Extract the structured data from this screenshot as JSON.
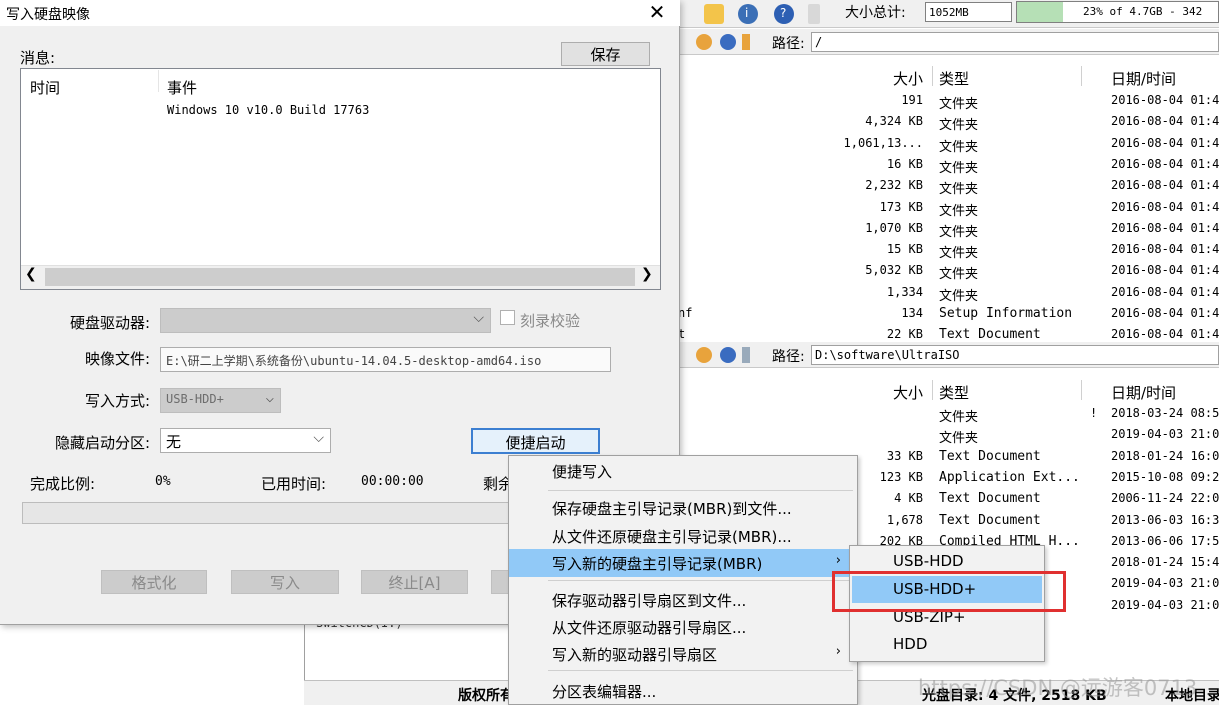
{
  "background": {
    "toolbar": {
      "size_label": "大小总计:",
      "size_value": "1052MB",
      "progress_text": "23% of 4.7GB - 342",
      "progress_percent": 23
    },
    "top_pane": {
      "path_label": "路径:",
      "path_value": "/",
      "headers": {
        "size": "大小",
        "type": "类型",
        "date": "日期/时间"
      },
      "rows": [
        {
          "name": "",
          "size": "191",
          "type": "文件夹",
          "date": "2016-08-04 01:4"
        },
        {
          "name": "",
          "size": "4,324 KB",
          "type": "文件夹",
          "date": "2016-08-04 01:4"
        },
        {
          "name": "",
          "size": "1,061,13...",
          "type": "文件夹",
          "date": "2016-08-04 01:4"
        },
        {
          "name": "",
          "size": "16 KB",
          "type": "文件夹",
          "date": "2016-08-04 01:4"
        },
        {
          "name": "",
          "size": "2,232 KB",
          "type": "文件夹",
          "date": "2016-08-04 01:4"
        },
        {
          "name": "",
          "size": "173 KB",
          "type": "文件夹",
          "date": "2016-08-04 01:4"
        },
        {
          "name": "",
          "size": "1,070 KB",
          "type": "文件夹",
          "date": "2016-08-04 01:4"
        },
        {
          "name": "",
          "size": "15 KB",
          "type": "文件夹",
          "date": "2016-08-04 01:4"
        },
        {
          "name": "",
          "size": "5,032 KB",
          "type": "文件夹",
          "date": "2016-08-04 01:4"
        },
        {
          "name": "",
          "size": "1,334",
          "type": "文件夹",
          "date": "2016-08-04 01:4"
        },
        {
          "name": "nf",
          "size": "134",
          "type": "Setup Information",
          "date": "2016-08-04 01:4"
        },
        {
          "name": "t",
          "size": "22 KB",
          "type": "Text Document",
          "date": "2016-08-04 01:4"
        }
      ]
    },
    "bottom_pane": {
      "path_label": "路径:",
      "path_value": "D:\\software\\UltraISO",
      "headers": {
        "size": "大小",
        "type": "类型",
        "date": "日期/时间"
      },
      "rows": [
        {
          "size": "",
          "type": "文件夹",
          "flag": "!",
          "date": "2018-03-24 08:5"
        },
        {
          "size": "",
          "type": "文件夹",
          "flag": "",
          "date": "2019-04-03 21:0"
        },
        {
          "size": "33 KB",
          "type": "Text Document",
          "flag": "",
          "date": "2018-01-24 16:0"
        },
        {
          "size": "123 KB",
          "type": "Application Ext...",
          "flag": "",
          "date": "2015-10-08 09:2"
        },
        {
          "size": "4 KB",
          "type": "Text Document",
          "flag": "",
          "date": "2006-11-24 22:0"
        },
        {
          "size": "1,678",
          "type": "Text Document",
          "flag": "",
          "date": "2013-06-03 16:3"
        },
        {
          "size": "202 KB",
          "type": "Compiled HTML H...",
          "flag": "",
          "date": "2013-06-06 17:5"
        },
        {
          "size": "",
          "type": "",
          "flag": "",
          "date": "2018-01-24 15:4"
        },
        {
          "size": "",
          "type": ")",
          "flag": "",
          "date": "2019-04-03 21:0"
        },
        {
          "size": "",
          "type": "",
          "flag": "",
          "date": "2019-04-03 21:0"
        }
      ]
    },
    "tree_item": "SwitchCD(I:)",
    "status": {
      "copyright": "版权所有",
      "count": "光盘目录: 4 文件, 2518 KB",
      "local": "本地目录"
    },
    "watermark": "https://CSDN @远游客0713"
  },
  "dialog": {
    "title": "写入硬盘映像",
    "messages_label": "消息:",
    "save_button": "保存",
    "columns": {
      "time": "时间",
      "event": "事件"
    },
    "message_line": "Windows 10 v10.0 Build 17763",
    "disk_drive_label": "硬盘驱动器:",
    "disk_drive_value": "",
    "verify_label": "刻录校验",
    "image_file_label": "映像文件:",
    "image_file_value": "E:\\研二上学期\\系统备份\\ubuntu-14.04.5-desktop-amd64.iso",
    "write_method_label": "写入方式:",
    "write_method_value": "USB-HDD+",
    "hidden_partition_label": "隐藏启动分区:",
    "hidden_partition_value": "无",
    "quick_boot_button": "便捷启动",
    "progress_label": "完成比例:",
    "progress_value": "0%",
    "elapsed_label": "已用时间:",
    "elapsed_value": "00:00:00",
    "remaining_label": "剩余",
    "progress_percent": 0,
    "buttons": {
      "format": "格式化",
      "write": "写入",
      "stop": "终止[A]"
    }
  },
  "context_menu": {
    "items": [
      {
        "label": "便捷写入",
        "has_submenu": false
      },
      {
        "label": "保存硬盘主引导记录(MBR)到文件...",
        "has_submenu": false
      },
      {
        "label": "从文件还原硬盘主引导记录(MBR)...",
        "has_submenu": false
      },
      {
        "label": "写入新的硬盘主引导记录(MBR)",
        "has_submenu": true,
        "active": true
      },
      {
        "label": "保存驱动器引导扇区到文件...",
        "has_submenu": false
      },
      {
        "label": "从文件还原驱动器引导扇区...",
        "has_submenu": false
      },
      {
        "label": "写入新的驱动器引导扇区",
        "has_submenu": true
      },
      {
        "label": "分区表编辑器...",
        "has_submenu": false
      }
    ],
    "submenu": [
      {
        "label": "USB-HDD"
      },
      {
        "label": "USB-HDD+",
        "active": true
      },
      {
        "label": "USB-ZIP+"
      },
      {
        "label": "HDD"
      }
    ]
  },
  "colors": {
    "menu_highlight": "#91c9f7",
    "annotation_box": "#e03030",
    "focus_border": "#3c7fd1"
  }
}
